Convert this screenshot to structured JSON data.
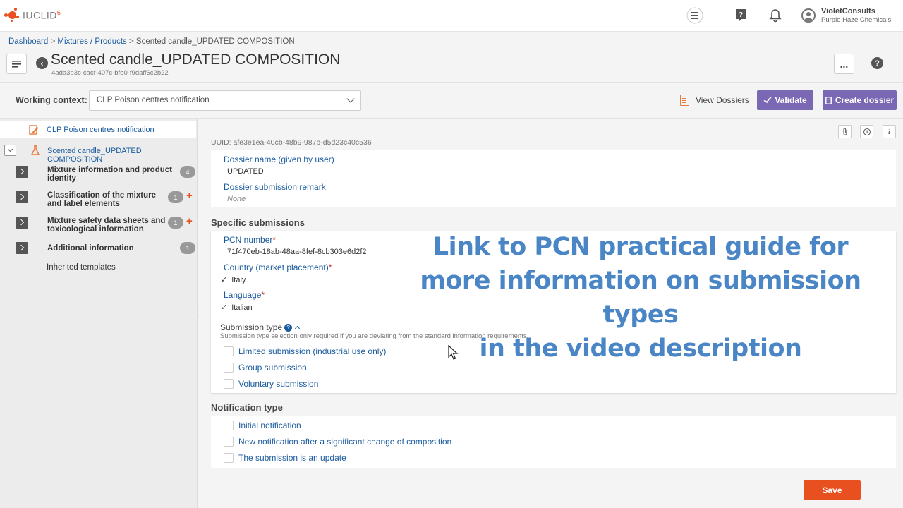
{
  "app": {
    "logo_text": "IUCLID",
    "logo_version": "6"
  },
  "user": {
    "name": "VioletConsults",
    "org": "Purple Haze Chemicals"
  },
  "breadcrumb": {
    "dashboard": "Dashboard",
    "sep1": " > ",
    "mixtures": "Mixtures / Products",
    "sep2": " > ",
    "current": "Scented candle_UPDATED COMPOSITION"
  },
  "page": {
    "title": "Scented candle_UPDATED COMPOSITION",
    "uuid": "4ada3b3c-cacf-407c-bfe0-f9daff6c2b22",
    "more_label": "...",
    "help_label": "?"
  },
  "context": {
    "label": "Working context:",
    "selected": "CLP Poison centres notification",
    "view_dossiers": "View Dossiers",
    "validate": "Validate",
    "create_dossier": "Create dossier"
  },
  "sidebar": {
    "top_item": "CLP Poison centres notification",
    "root_item": "Scented candle_UPDATED COMPOSITION",
    "items": [
      {
        "label": "Mixture information and product identity",
        "count": "4"
      },
      {
        "label": "Classification of the mixture and label elements",
        "count": "1"
      },
      {
        "label": "Mixture safety data sheets and toxicological information",
        "count": "1"
      },
      {
        "label": "Additional information",
        "count": "1"
      }
    ],
    "inherited": "Inherited templates"
  },
  "main": {
    "uuid_line": "UUID:  afe3e1ea-40cb-48b9-987b-d5d23c40c536",
    "dossier_name_label": "Dossier name (given by user)",
    "dossier_name_value": "UPDATED",
    "remark_label": "Dossier submission remark",
    "remark_value": "None",
    "specific_title": "Specific submissions",
    "pcn_label": "PCN number",
    "pcn_value": "71f470eb-18ab-48aa-8fef-8cb303e6d2f2",
    "country_label": "Country (market placement)",
    "country_value": "Italy",
    "language_label": "Language",
    "language_value": "Italian",
    "required_mark": "*",
    "check_mark": "✓",
    "submission_type_label": "Submission type",
    "submission_type_help": "Submission type selection only required if you are deviating from the standard information requirements.",
    "submission_options": [
      "Limited submission (industrial use only)",
      "Group submission",
      "Voluntary submission"
    ],
    "notification_title": "Notification type",
    "notification_options": [
      "Initial notification",
      "New notification after a significant change of composition",
      "The submission is an update"
    ]
  },
  "overlay": {
    "line1": "Link to PCN practical guide for",
    "line2": "more information on submission types",
    "line3": "in the video description"
  },
  "footer": {
    "save": "Save"
  },
  "colors": {
    "accent_blue": "#1a5a9e",
    "purple_button": "#7b68b4",
    "save_orange": "#e8501f",
    "overlay_blue": "#4a86c5"
  }
}
